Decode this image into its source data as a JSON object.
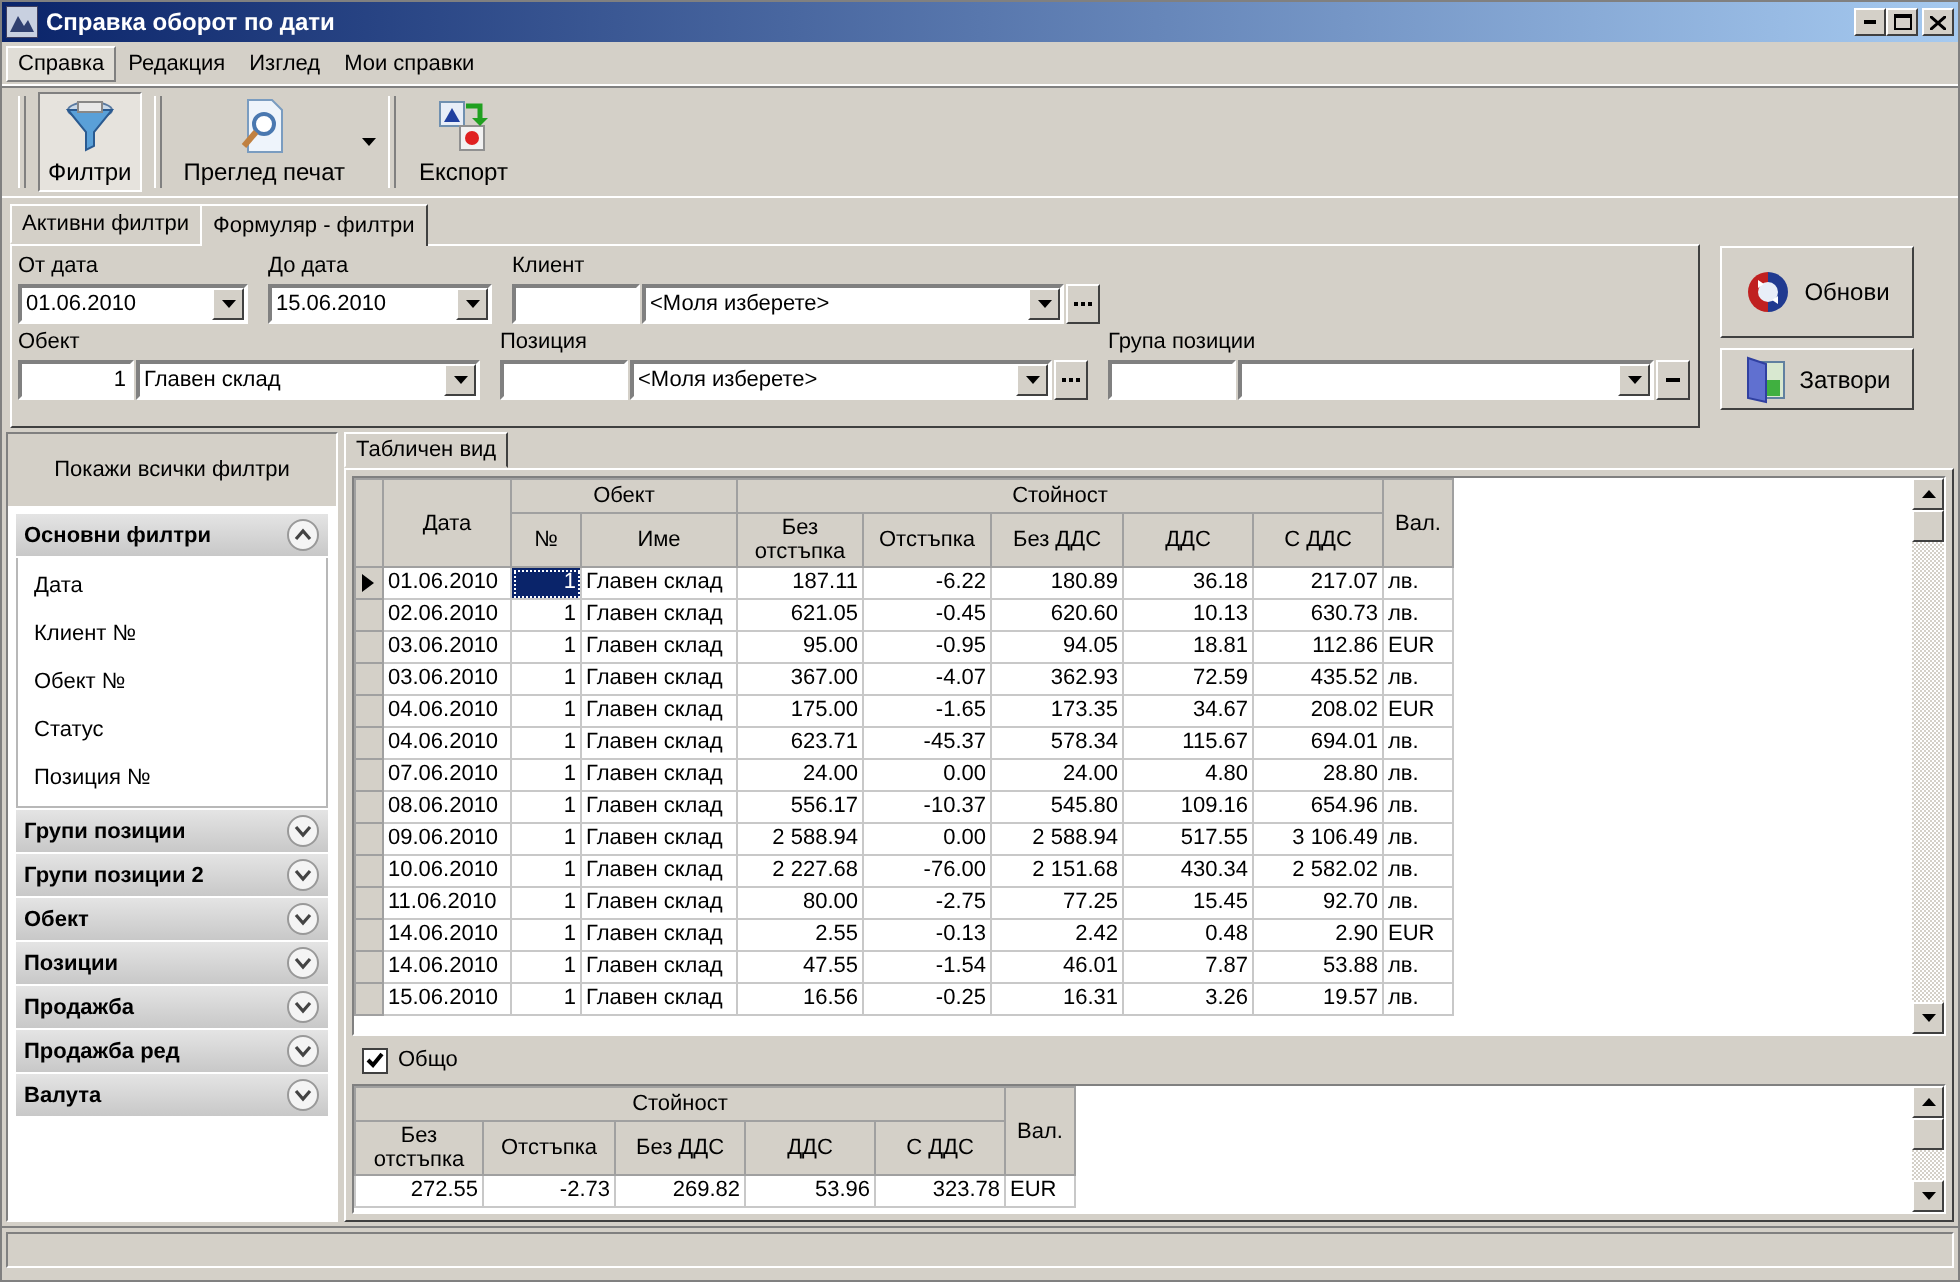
{
  "window": {
    "title": "Справка оборот по дати"
  },
  "menu": [
    {
      "label": "Справка",
      "selected": true
    },
    {
      "label": "Редакция",
      "selected": false
    },
    {
      "label": "Изглед",
      "selected": false
    },
    {
      "label": "Мои справки",
      "selected": false
    }
  ],
  "toolbar": [
    {
      "label": "Филтри",
      "kind": "filter",
      "pressed": true,
      "dropdown": false
    },
    {
      "label": "Преглед печат",
      "kind": "preview",
      "pressed": false,
      "dropdown": true
    },
    {
      "label": "Експорт",
      "kind": "export",
      "pressed": false,
      "dropdown": false
    }
  ],
  "filter_tabs": [
    {
      "label": "Активни филтри",
      "selected": false
    },
    {
      "label": "Формуляр - филтри",
      "selected": true
    }
  ],
  "filter_rows": [
    [
      {
        "kind": "date",
        "label": "От дата",
        "value": "01.06.2010"
      },
      {
        "kind": "date",
        "label": "До дата",
        "value": "15.06.2010"
      },
      {
        "kind": "lookup",
        "label": "Клиент",
        "value": "<Моля изберете>"
      }
    ],
    [
      {
        "kind": "combo",
        "label": "Обект",
        "code": "1",
        "value": "Главен склад"
      },
      {
        "kind": "lookup",
        "label": "Позиция",
        "value": "<Моля изберете>"
      },
      {
        "kind": "group",
        "label": "Група позиции"
      }
    ]
  ],
  "actions": [
    {
      "label": "Обнови",
      "kind": "refresh"
    },
    {
      "label": "Затвори",
      "kind": "close"
    }
  ],
  "sidebar": {
    "show_all": "Покажи всички филтри",
    "groups": [
      {
        "label": "Основни филтри",
        "expanded": true,
        "items": [
          "Дата",
          "Клиент №",
          "Обект №",
          "Статус",
          "Позиция №"
        ]
      },
      {
        "label": "Групи позиции",
        "expanded": false
      },
      {
        "label": "Групи позиции 2",
        "expanded": false
      },
      {
        "label": "Обект",
        "expanded": false
      },
      {
        "label": "Позиции",
        "expanded": false
      },
      {
        "label": "Продажба",
        "expanded": false
      },
      {
        "label": "Продажба ред",
        "expanded": false
      },
      {
        "label": "Валута",
        "expanded": false
      }
    ]
  },
  "view_tabs": [
    {
      "label": "Табличен вид",
      "selected": true
    }
  ],
  "table": {
    "columns": {
      "date": "Дата",
      "object": "Обект",
      "object_no": "№",
      "object_name": "Име",
      "value": "Стойност",
      "value_cols": [
        "Без отстъпка",
        "Отстъпка",
        "Без ДДС",
        "ДДС",
        "С ДДС"
      ],
      "currency": "Вал."
    },
    "rows": [
      {
        "selected": true,
        "cells": [
          "01.06.2010",
          "1",
          "Главен склад",
          "187.11",
          "-6.22",
          "180.89",
          "36.18",
          "217.07",
          "лв."
        ]
      },
      {
        "selected": false,
        "cells": [
          "02.06.2010",
          "1",
          "Главен склад",
          "621.05",
          "-0.45",
          "620.60",
          "10.13",
          "630.73",
          "лв."
        ]
      },
      {
        "selected": false,
        "cells": [
          "03.06.2010",
          "1",
          "Главен склад",
          "95.00",
          "-0.95",
          "94.05",
          "18.81",
          "112.86",
          "EUR"
        ]
      },
      {
        "selected": false,
        "cells": [
          "03.06.2010",
          "1",
          "Главен склад",
          "367.00",
          "-4.07",
          "362.93",
          "72.59",
          "435.52",
          "лв."
        ]
      },
      {
        "selected": false,
        "cells": [
          "04.06.2010",
          "1",
          "Главен склад",
          "175.00",
          "-1.65",
          "173.35",
          "34.67",
          "208.02",
          "EUR"
        ]
      },
      {
        "selected": false,
        "cells": [
          "04.06.2010",
          "1",
          "Главен склад",
          "623.71",
          "-45.37",
          "578.34",
          "115.67",
          "694.01",
          "лв."
        ]
      },
      {
        "selected": false,
        "cells": [
          "07.06.2010",
          "1",
          "Главен склад",
          "24.00",
          "0.00",
          "24.00",
          "4.80",
          "28.80",
          "лв."
        ]
      },
      {
        "selected": false,
        "cells": [
          "08.06.2010",
          "1",
          "Главен склад",
          "556.17",
          "-10.37",
          "545.80",
          "109.16",
          "654.96",
          "лв."
        ]
      },
      {
        "selected": false,
        "cells": [
          "09.06.2010",
          "1",
          "Главен склад",
          "2 588.94",
          "0.00",
          "2 588.94",
          "517.55",
          "3 106.49",
          "лв."
        ]
      },
      {
        "selected": false,
        "cells": [
          "10.06.2010",
          "1",
          "Главен склад",
          "2 227.68",
          "-76.00",
          "2 151.68",
          "430.34",
          "2 582.02",
          "лв."
        ]
      },
      {
        "selected": false,
        "cells": [
          "11.06.2010",
          "1",
          "Главен склад",
          "80.00",
          "-2.75",
          "77.25",
          "15.45",
          "92.70",
          "лв."
        ]
      },
      {
        "selected": false,
        "cells": [
          "14.06.2010",
          "1",
          "Главен склад",
          "2.55",
          "-0.13",
          "2.42",
          "0.48",
          "2.90",
          "EUR"
        ]
      },
      {
        "selected": false,
        "cells": [
          "14.06.2010",
          "1",
          "Главен склад",
          "47.55",
          "-1.54",
          "46.01",
          "7.87",
          "53.88",
          "лв."
        ]
      },
      {
        "selected": false,
        "cells": [
          "15.06.2010",
          "1",
          "Главен склад",
          "16.56",
          "-0.25",
          "16.31",
          "3.26",
          "19.57",
          "лв."
        ]
      }
    ]
  },
  "total": {
    "label": "Общо",
    "checked": true,
    "columns": {
      "value": "Стойност",
      "value_cols": [
        "Без отстъпка",
        "Отстъпка",
        "Без ДДС",
        "ДДС",
        "С ДДС"
      ],
      "currency": "Вал."
    },
    "row": [
      "272.55",
      "-2.73",
      "269.82",
      "53.96",
      "323.78",
      "EUR"
    ]
  }
}
